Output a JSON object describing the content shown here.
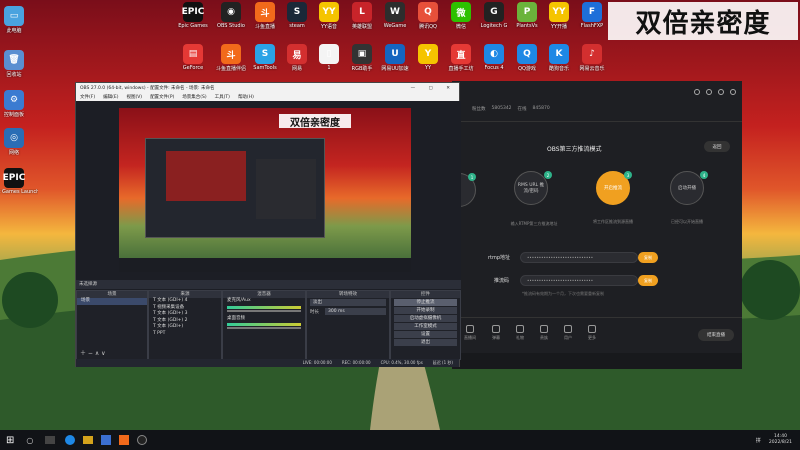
{
  "banner": {
    "text": "双倍亲密度"
  },
  "desktop_icons": [
    {
      "label": "此电脑",
      "color": "#4aa3df",
      "glyph": "▭"
    },
    {
      "label": "回收站",
      "color": "#5a8fd1",
      "glyph": "🗑"
    },
    {
      "label": "控制面板",
      "color": "#3b7bd1",
      "glyph": "⚙"
    },
    {
      "label": "网络",
      "color": "#2a6db5",
      "glyph": "◎"
    },
    {
      "label": "Epic Games Launcher",
      "color": "#111",
      "glyph": "EPIC"
    },
    {
      "label": "Epic Games",
      "color": "#111",
      "glyph": "EPIC"
    },
    {
      "label": "OBS Studio",
      "color": "#222",
      "glyph": "◉"
    },
    {
      "label": "斗鱼直播",
      "color": "#f26a1b",
      "glyph": "斗"
    },
    {
      "label": "steam",
      "color": "#1b2838",
      "glyph": "S"
    },
    {
      "label": "YY语音",
      "color": "#f5c400",
      "glyph": "YY"
    },
    {
      "label": "英雄联盟",
      "color": "#c8242a",
      "glyph": "L"
    },
    {
      "label": "WeGame",
      "color": "#2d2d2d",
      "glyph": "W"
    },
    {
      "label": "腾讯QQ",
      "color": "#e7503a",
      "glyph": "Q"
    },
    {
      "label": "微信",
      "color": "#2dc100",
      "glyph": "微"
    },
    {
      "label": "Logitech G",
      "color": "#222",
      "glyph": "G"
    },
    {
      "label": "PlantsVs",
      "color": "#6bb33b",
      "glyph": "P"
    },
    {
      "label": "YY开播",
      "color": "#f5c400",
      "glyph": "YY"
    },
    {
      "label": "FlashFXP",
      "color": "#1e6fd9",
      "glyph": "F"
    },
    {
      "label": "GeForce",
      "color": "#e53935",
      "glyph": "▤"
    },
    {
      "label": "斗鱼直播伴侣",
      "color": "#f26a1b",
      "glyph": "斗"
    },
    {
      "label": "SamTools",
      "color": "#2aa3e6",
      "glyph": "S"
    },
    {
      "label": "网易",
      "color": "#d32f2f",
      "glyph": "易"
    },
    {
      "label": "1",
      "color": "#f4f4f4",
      "glyph": "▯"
    },
    {
      "label": "RGB助手",
      "color": "#333",
      "glyph": "▣"
    },
    {
      "label": "网易UU加速",
      "color": "#1565c0",
      "glyph": "U"
    },
    {
      "label": "YY",
      "color": "#f5c400",
      "glyph": "Y"
    },
    {
      "label": "直播手工坊",
      "color": "#e53935",
      "glyph": "直"
    },
    {
      "label": "Focus 4",
      "color": "#1e88e5",
      "glyph": "◐"
    },
    {
      "label": "QQ游戏",
      "color": "#1e88e5",
      "glyph": "Q"
    },
    {
      "label": "酷狗音乐",
      "color": "#1e88e5",
      "glyph": "K"
    },
    {
      "label": "网易云音乐",
      "color": "#d32f2f",
      "glyph": "♪"
    },
    {
      "label": "网易",
      "color": "#d32f2f",
      "glyph": "易"
    }
  ],
  "obs": {
    "title": "OBS 27.0.0 (64-bit, windows) - 配置文件: 未命名 - 场景: 未命名",
    "menu": [
      "文件(F)",
      "编辑(E)",
      "视图(V)",
      "配置文件(P)",
      "场景集合(S)",
      "工具(T)",
      "帮助(H)"
    ],
    "source_bar": "未选择源",
    "scene_header": "场景",
    "scenes": [
      "场景"
    ],
    "sources_header": "来源",
    "sources": [
      "文本 (GDI+) 4",
      "视频采集设备",
      "文本 (GDI+) 3",
      "文本 (GDI+) 2",
      "文本 (GDI+)",
      "PPT"
    ],
    "mixer_header": "混音器",
    "mixer": [
      {
        "label": "麦克风/Aux",
        "db": "0.0 dB"
      },
      {
        "label": "桌面音频",
        "db": "0.0 dB"
      }
    ],
    "transition_header": "转场特效",
    "transition_type": "淡出",
    "duration_label": "时长",
    "duration": "300 ms",
    "controls_header": "控件",
    "controls": [
      "停止推流",
      "开始录制",
      "启动虚拟摄像机",
      "工作室模式",
      "设置",
      "退出"
    ],
    "status": [
      "LIVE: 00:00:00",
      "REC: 00:00:00",
      "CPU: 0.4%, 30.00 fps",
      "延迟 (1 秒)"
    ],
    "preview_banner": "双倍亲密度"
  },
  "right_app": {
    "header_stats": [
      "粉丝数",
      "5805342",
      "在线",
      "845870"
    ],
    "section_title": "OBS第三方推流模式",
    "back_button": "返回",
    "steps": [
      {
        "n": "1",
        "label": ""
      },
      {
        "n": "2",
        "label": "RMS URL 推流/密码"
      },
      {
        "n": "3",
        "label": "开启推流"
      },
      {
        "n": "4",
        "label": "启动开播"
      }
    ],
    "step_desc": [
      "输入RTMP第三方推流地址",
      "将工作区推流到源直播",
      "开启推流地址及推流地址",
      "已经可以开始直播"
    ],
    "rtmp_label": "rtmp地址",
    "rtmp_value": "••••••••••••••••••••••••••••",
    "key_label": "推流码",
    "key_value": "••••••••••••••••••••••••••••",
    "copy_button": "复制",
    "hint": "*推流码有效期为一个月，下次也需要重新复制",
    "bottom_icons": [
      "直播间",
      "弹幕",
      "礼物",
      "贵族",
      "用户",
      "更多"
    ],
    "end_button": "结束直播"
  },
  "taskbar": {
    "time": "14:40",
    "date": "2022/8/21",
    "lang": "拼"
  }
}
